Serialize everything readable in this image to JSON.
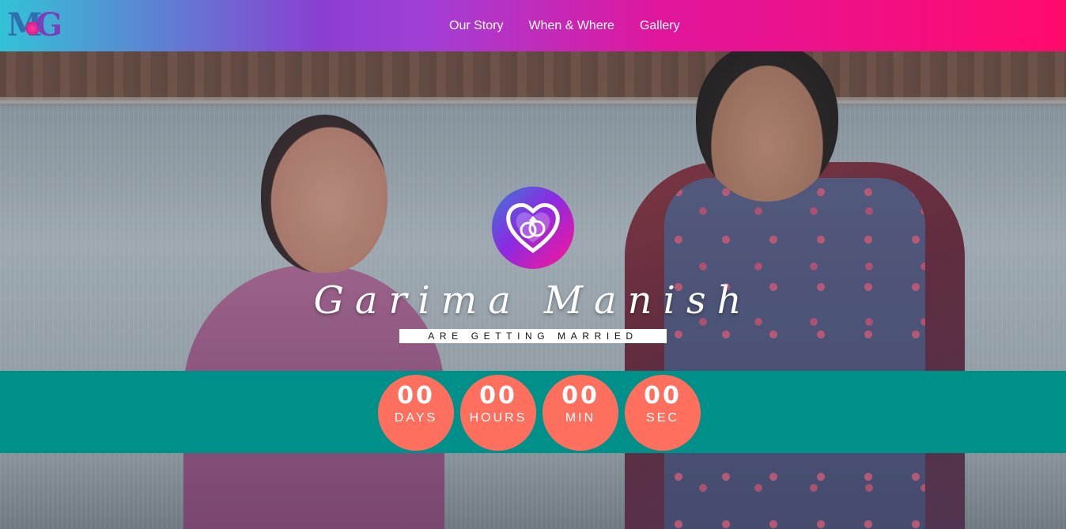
{
  "header": {
    "logo": {
      "letters": "MG",
      "icon": "monogram-logo"
    },
    "nav": [
      {
        "label": "Our Story"
      },
      {
        "label": "When & Where"
      },
      {
        "label": "Gallery"
      }
    ],
    "gradient_colors": [
      "#33c2d6",
      "#a23fd6",
      "#ff0a6c"
    ]
  },
  "hero": {
    "emblem_icon": "heart-rings-icon",
    "bride_name": "Garima",
    "groom_name": "Manish",
    "separator_icon": "double-hearts-icon",
    "tagline": "ARE GETTING MARRIED"
  },
  "countdown": {
    "band_color": "#00908a",
    "circle_color": "#ff6f5e",
    "days": {
      "value": "00",
      "label": "DAYS"
    },
    "hours": {
      "value": "00",
      "label": "HOURS"
    },
    "minutes": {
      "value": "00",
      "label": "MIN"
    },
    "seconds": {
      "value": "00",
      "label": "SEC"
    }
  }
}
